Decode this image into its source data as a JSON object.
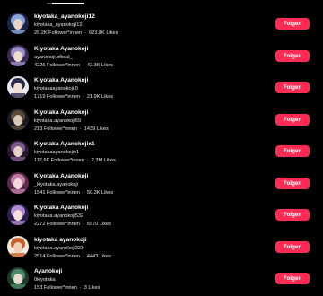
{
  "colors": {
    "background": "#000000",
    "accent": "#fe2c55",
    "text": "#ffffff"
  },
  "button_label": "Folgen",
  "accounts": [
    {
      "name": "kiyotaka_ayanokoji12",
      "handle": "kiyotaka_ayanokoji12",
      "followers": "28.2K Follower*innen",
      "likes": "623.8K Likes",
      "avatar_colors": [
        "#1d2545",
        "#8aa6d6",
        "#e8d5c8"
      ]
    },
    {
      "name": "Kiyotaka Ayanokoji",
      "handle": "ayanokoji.oficial_",
      "followers": "4226 Follower*innen",
      "likes": "42.3K Likes",
      "avatar_colors": [
        "#3a2a55",
        "#9b8fc9",
        "#f0dcd0"
      ]
    },
    {
      "name": "Kiyotaka Ayanokoji",
      "handle": "kiyotakaayanokoji.0",
      "followers": "1719 Follower*innen",
      "likes": "21.9K Likes",
      "avatar_colors": [
        "#e8eaf2",
        "#2b2b4a",
        "#f2e0d4"
      ]
    },
    {
      "name": "Kiyotaka Ayanokoji",
      "handle": "kiyotaka.ayanokoji69",
      "followers": "213 Follower*innen",
      "likes": "1439 Likes",
      "avatar_colors": [
        "#1a1a22",
        "#5a4a3a",
        "#d8c8b8"
      ]
    },
    {
      "name": "Kiyotaka Ayanokojix1",
      "handle": "kiyotakaayanokojix1",
      "followers": "112,6K Follower*innen",
      "likes": "2,3M Likes",
      "avatar_colors": [
        "#2a1830",
        "#7a5a8a",
        "#e6d0c8"
      ]
    },
    {
      "name": "Kiyotaka Ayanokoji",
      "handle": "_kiyotaka.ayanokoji",
      "followers": "1541 Follower*innen",
      "likes": "50.3K Likes",
      "avatar_colors": [
        "#5a2a4a",
        "#c27aa8",
        "#f0d8d8"
      ]
    },
    {
      "name": "Kiyotaka Ayanokoji",
      "handle": "kiyotaka.ayanokoji532",
      "followers": "2272 Follower*innen",
      "likes": "6570 Likes",
      "avatar_colors": [
        "#2a2050",
        "#b08ad0",
        "#f4e0d8"
      ]
    },
    {
      "name": "kiyotaka ayanokoji",
      "handle": "kiyotaka.ayanokoji323",
      "followers": "2514 Follower*innen",
      "likes": "4443 Likes",
      "avatar_colors": [
        "#f2e8e0",
        "#c4622a",
        "#f0d0b8"
      ]
    },
    {
      "name": "Ayanokoji",
      "handle": "0kiyotaka",
      "followers": "153 Follower*innen",
      "likes": "3 Likes",
      "avatar_colors": [
        "#1e3a2a",
        "#4a8a6a",
        "#e8dccf"
      ]
    }
  ]
}
